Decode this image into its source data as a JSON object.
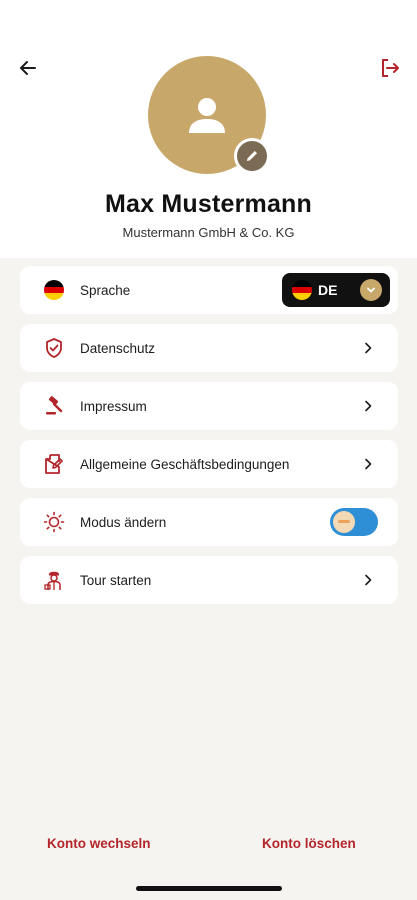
{
  "profile": {
    "name": "Max Mustermann",
    "company": "Mustermann GmbH & Co. KG"
  },
  "header": {
    "back_icon": "arrow-left-icon",
    "logout_icon": "logout-icon",
    "edit_icon": "pencil-icon"
  },
  "menu": {
    "language": {
      "label": "Sprache",
      "value": "DE",
      "icon": "flag-germany-icon"
    },
    "privacy": {
      "label": "Datenschutz",
      "icon": "shield-check-icon"
    },
    "imprint": {
      "label": "Impressum",
      "icon": "gavel-icon"
    },
    "terms": {
      "label": "Allgemeine Geschäftsbedingungen",
      "icon": "document-edit-icon"
    },
    "mode": {
      "label": "Modus ändern",
      "icon": "sun-icon",
      "toggle_on": true
    },
    "tour": {
      "label": "Tour starten",
      "icon": "tour-guide-icon"
    }
  },
  "footer": {
    "switch_account": "Konto wechseln",
    "delete_account": "Konto löschen"
  },
  "colors": {
    "accent_red": "#b3252a",
    "gold": "#c8a86a",
    "toggle_blue": "#2f8fd6"
  }
}
